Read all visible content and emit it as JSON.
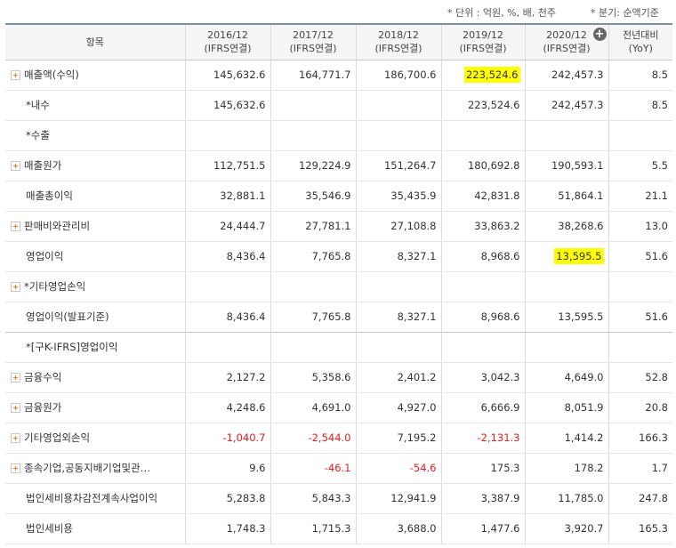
{
  "units": {
    "left": "* 단위 : 억원, %, 배, 천주",
    "right": "* 분기: 순액기준"
  },
  "columns": [
    {
      "line1": "항목",
      "line2": ""
    },
    {
      "line1": "2016/12",
      "line2": "(IFRS연결)"
    },
    {
      "line1": "2017/12",
      "line2": "(IFRS연결)"
    },
    {
      "line1": "2018/12",
      "line2": "(IFRS연결)"
    },
    {
      "line1": "2019/12",
      "line2": "(IFRS연결)"
    },
    {
      "line1": "2020/12",
      "line2": "(IFRS연결)"
    },
    {
      "line1": "전년대비",
      "line2": "(YoY)"
    }
  ],
  "rows": [
    {
      "label": "매출액(수익)",
      "expand": true,
      "cells": [
        "145,632.6",
        "164,771.7",
        "186,700.6",
        "223,524.6",
        "242,457.3",
        "8.5"
      ]
    },
    {
      "label": "*내수",
      "expand": false,
      "cells": [
        "145,632.6",
        "",
        "",
        "223,524.6",
        "242,457.3",
        "8.5"
      ]
    },
    {
      "label": "*수출",
      "expand": false,
      "cells": [
        "",
        "",
        "",
        "",
        "",
        ""
      ]
    },
    {
      "label": "매출원가",
      "expand": true,
      "cells": [
        "112,751.5",
        "129,224.9",
        "151,264.7",
        "180,692.8",
        "190,593.1",
        "5.5"
      ]
    },
    {
      "label": "매출총이익",
      "expand": false,
      "cells": [
        "32,881.1",
        "35,546.9",
        "35,435.9",
        "42,831.8",
        "51,864.1",
        "21.1"
      ]
    },
    {
      "label": "판매비와관리비",
      "expand": true,
      "cells": [
        "24,444.7",
        "27,781.1",
        "27,108.8",
        "33,863.2",
        "38,268.6",
        "13.0"
      ]
    },
    {
      "label": "영업이익",
      "expand": false,
      "cells": [
        "8,436.4",
        "7,765.8",
        "8,327.1",
        "8,968.6",
        "13,595.5",
        "51.6"
      ]
    },
    {
      "label": "*기타영업손익",
      "expand": true,
      "cells": [
        "",
        "",
        "",
        "",
        "",
        ""
      ]
    },
    {
      "label": "영업이익(발표기준)",
      "expand": false,
      "cells": [
        "8,436.4",
        "7,765.8",
        "8,327.1",
        "8,968.6",
        "13,595.5",
        "51.6"
      ]
    },
    {
      "label": "*[구K-IFRS]영업이익",
      "expand": false,
      "cells": [
        "",
        "",
        "",
        "",
        "",
        ""
      ]
    },
    {
      "label": "금융수익",
      "expand": true,
      "cells": [
        "2,127.2",
        "5,358.6",
        "2,401.2",
        "3,042.3",
        "4,649.0",
        "52.8"
      ]
    },
    {
      "label": "금융원가",
      "expand": true,
      "cells": [
        "4,248.6",
        "4,691.0",
        "4,927.0",
        "6,666.9",
        "8,051.9",
        "20.8"
      ]
    },
    {
      "label": "기타영업외손익",
      "expand": true,
      "cells": [
        "-1,040.7",
        "-2,544.0",
        "7,195.2",
        "-2,131.3",
        "1,414.2",
        "166.3"
      ]
    },
    {
      "label": "종속기업,공동지배기업및관…",
      "expand": true,
      "cells": [
        "9.6",
        "-46.1",
        "-54.6",
        "175.3",
        "178.2",
        "1.7"
      ]
    },
    {
      "label": "법인세비용차감전계속사업이익",
      "expand": false,
      "cells": [
        "5,283.8",
        "5,843.3",
        "12,941.9",
        "3,387.9",
        "11,785.0",
        "247.8"
      ]
    },
    {
      "label": "법인세비용",
      "expand": false,
      "cells": [
        "1,748.3",
        "1,715.3",
        "3,688.0",
        "1,477.6",
        "3,920.7",
        "165.3"
      ]
    }
  ],
  "highlights": [
    {
      "row": 0,
      "col": 3
    },
    {
      "row": 6,
      "col": 4
    }
  ],
  "header_icon": "add-column-icon",
  "colors": {
    "highlight": "#ffff00",
    "negative": "#e02020",
    "expand_icon": "#f07c2a",
    "header_bg": "#f5f5f5"
  }
}
